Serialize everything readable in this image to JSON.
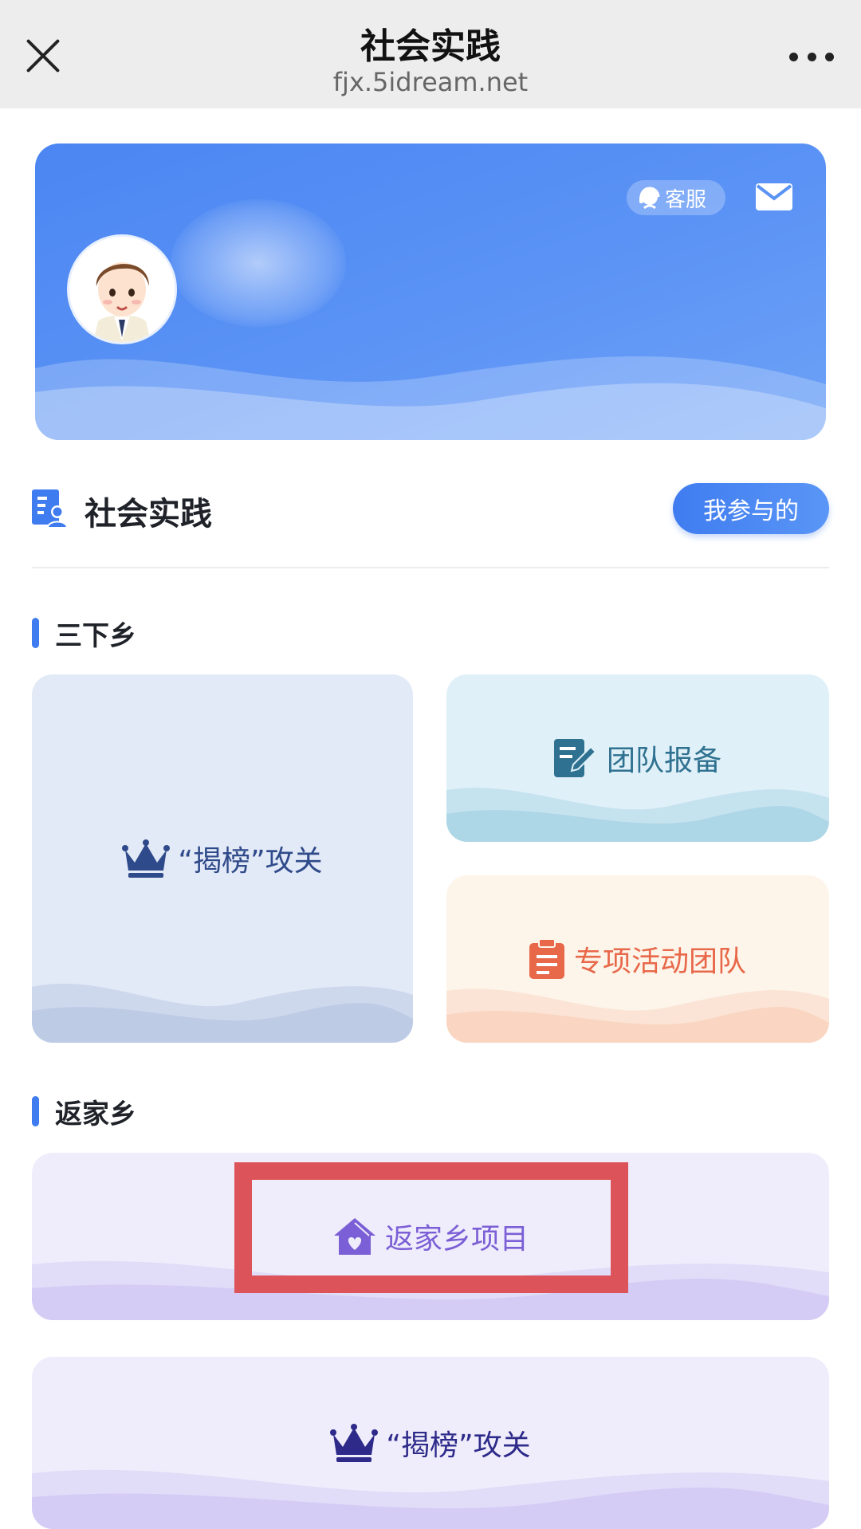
{
  "navbar": {
    "title": "社会实践",
    "url": "fjx.5idream.net"
  },
  "banner": {
    "service_label": "客服"
  },
  "section": {
    "title": "社会实践",
    "mine_button": "我参与的"
  },
  "groups": [
    {
      "title": "三下乡",
      "cards": [
        {
          "label": "“揭榜”攻关",
          "icon": "crown-icon",
          "color": "#2f4a8a"
        },
        {
          "label": "团队报备",
          "icon": "edit-form-icon",
          "color": "#2f7190"
        },
        {
          "label": "专项活动团队",
          "icon": "clipboard-icon",
          "color": "#e8684a"
        }
      ]
    },
    {
      "title": "返家乡",
      "cards": [
        {
          "label": "返家乡项目",
          "icon": "home-heart-icon",
          "color": "#7b5fd6"
        },
        {
          "label": "“揭榜”攻关",
          "icon": "crown-icon",
          "color": "#2d2a8a"
        }
      ]
    }
  ],
  "colors": {
    "accent": "#3f7cf0",
    "highlight": "#dc5459"
  }
}
